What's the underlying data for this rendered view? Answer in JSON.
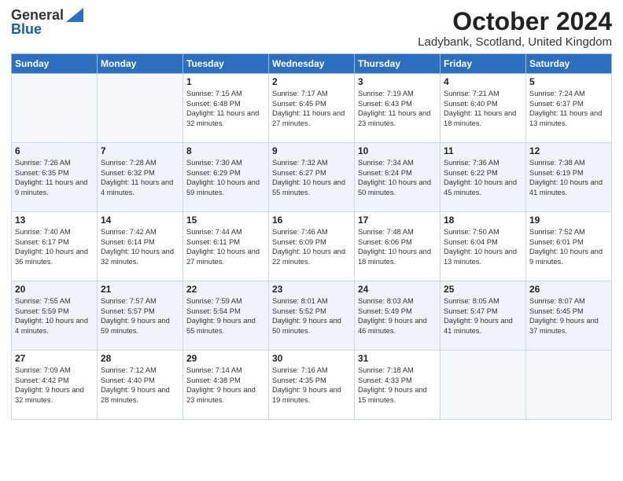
{
  "header": {
    "logo_general": "General",
    "logo_blue": "Blue",
    "month_title": "October 2024",
    "location": "Ladybank, Scotland, United Kingdom"
  },
  "days_of_week": [
    "Sunday",
    "Monday",
    "Tuesday",
    "Wednesday",
    "Thursday",
    "Friday",
    "Saturday"
  ],
  "weeks": [
    [
      {
        "day": "",
        "info": ""
      },
      {
        "day": "",
        "info": ""
      },
      {
        "day": "1",
        "info": "Sunrise: 7:15 AM\nSunset: 6:48 PM\nDaylight: 11 hours and 32 minutes."
      },
      {
        "day": "2",
        "info": "Sunrise: 7:17 AM\nSunset: 6:45 PM\nDaylight: 11 hours and 27 minutes."
      },
      {
        "day": "3",
        "info": "Sunrise: 7:19 AM\nSunset: 6:43 PM\nDaylight: 11 hours and 23 minutes."
      },
      {
        "day": "4",
        "info": "Sunrise: 7:21 AM\nSunset: 6:40 PM\nDaylight: 11 hours and 18 minutes."
      },
      {
        "day": "5",
        "info": "Sunrise: 7:24 AM\nSunset: 6:37 PM\nDaylight: 11 hours and 13 minutes."
      }
    ],
    [
      {
        "day": "6",
        "info": "Sunrise: 7:26 AM\nSunset: 6:35 PM\nDaylight: 11 hours and 9 minutes."
      },
      {
        "day": "7",
        "info": "Sunrise: 7:28 AM\nSunset: 6:32 PM\nDaylight: 11 hours and 4 minutes."
      },
      {
        "day": "8",
        "info": "Sunrise: 7:30 AM\nSunset: 6:29 PM\nDaylight: 10 hours and 59 minutes."
      },
      {
        "day": "9",
        "info": "Sunrise: 7:32 AM\nSunset: 6:27 PM\nDaylight: 10 hours and 55 minutes."
      },
      {
        "day": "10",
        "info": "Sunrise: 7:34 AM\nSunset: 6:24 PM\nDaylight: 10 hours and 50 minutes."
      },
      {
        "day": "11",
        "info": "Sunrise: 7:36 AM\nSunset: 6:22 PM\nDaylight: 10 hours and 45 minutes."
      },
      {
        "day": "12",
        "info": "Sunrise: 7:38 AM\nSunset: 6:19 PM\nDaylight: 10 hours and 41 minutes."
      }
    ],
    [
      {
        "day": "13",
        "info": "Sunrise: 7:40 AM\nSunset: 6:17 PM\nDaylight: 10 hours and 36 minutes."
      },
      {
        "day": "14",
        "info": "Sunrise: 7:42 AM\nSunset: 6:14 PM\nDaylight: 10 hours and 32 minutes."
      },
      {
        "day": "15",
        "info": "Sunrise: 7:44 AM\nSunset: 6:11 PM\nDaylight: 10 hours and 27 minutes."
      },
      {
        "day": "16",
        "info": "Sunrise: 7:46 AM\nSunset: 6:09 PM\nDaylight: 10 hours and 22 minutes."
      },
      {
        "day": "17",
        "info": "Sunrise: 7:48 AM\nSunset: 6:06 PM\nDaylight: 10 hours and 18 minutes."
      },
      {
        "day": "18",
        "info": "Sunrise: 7:50 AM\nSunset: 6:04 PM\nDaylight: 10 hours and 13 minutes."
      },
      {
        "day": "19",
        "info": "Sunrise: 7:52 AM\nSunset: 6:01 PM\nDaylight: 10 hours and 9 minutes."
      }
    ],
    [
      {
        "day": "20",
        "info": "Sunrise: 7:55 AM\nSunset: 5:59 PM\nDaylight: 10 hours and 4 minutes."
      },
      {
        "day": "21",
        "info": "Sunrise: 7:57 AM\nSunset: 5:57 PM\nDaylight: 9 hours and 59 minutes."
      },
      {
        "day": "22",
        "info": "Sunrise: 7:59 AM\nSunset: 5:54 PM\nDaylight: 9 hours and 55 minutes."
      },
      {
        "day": "23",
        "info": "Sunrise: 8:01 AM\nSunset: 5:52 PM\nDaylight: 9 hours and 50 minutes."
      },
      {
        "day": "24",
        "info": "Sunrise: 8:03 AM\nSunset: 5:49 PM\nDaylight: 9 hours and 46 minutes."
      },
      {
        "day": "25",
        "info": "Sunrise: 8:05 AM\nSunset: 5:47 PM\nDaylight: 9 hours and 41 minutes."
      },
      {
        "day": "26",
        "info": "Sunrise: 8:07 AM\nSunset: 5:45 PM\nDaylight: 9 hours and 37 minutes."
      }
    ],
    [
      {
        "day": "27",
        "info": "Sunrise: 7:09 AM\nSunset: 4:42 PM\nDaylight: 9 hours and 32 minutes."
      },
      {
        "day": "28",
        "info": "Sunrise: 7:12 AM\nSunset: 4:40 PM\nDaylight: 9 hours and 28 minutes."
      },
      {
        "day": "29",
        "info": "Sunrise: 7:14 AM\nSunset: 4:38 PM\nDaylight: 9 hours and 23 minutes."
      },
      {
        "day": "30",
        "info": "Sunrise: 7:16 AM\nSunset: 4:35 PM\nDaylight: 9 hours and 19 minutes."
      },
      {
        "day": "31",
        "info": "Sunrise: 7:18 AM\nSunset: 4:33 PM\nDaylight: 9 hours and 15 minutes."
      },
      {
        "day": "",
        "info": ""
      },
      {
        "day": "",
        "info": ""
      }
    ]
  ]
}
